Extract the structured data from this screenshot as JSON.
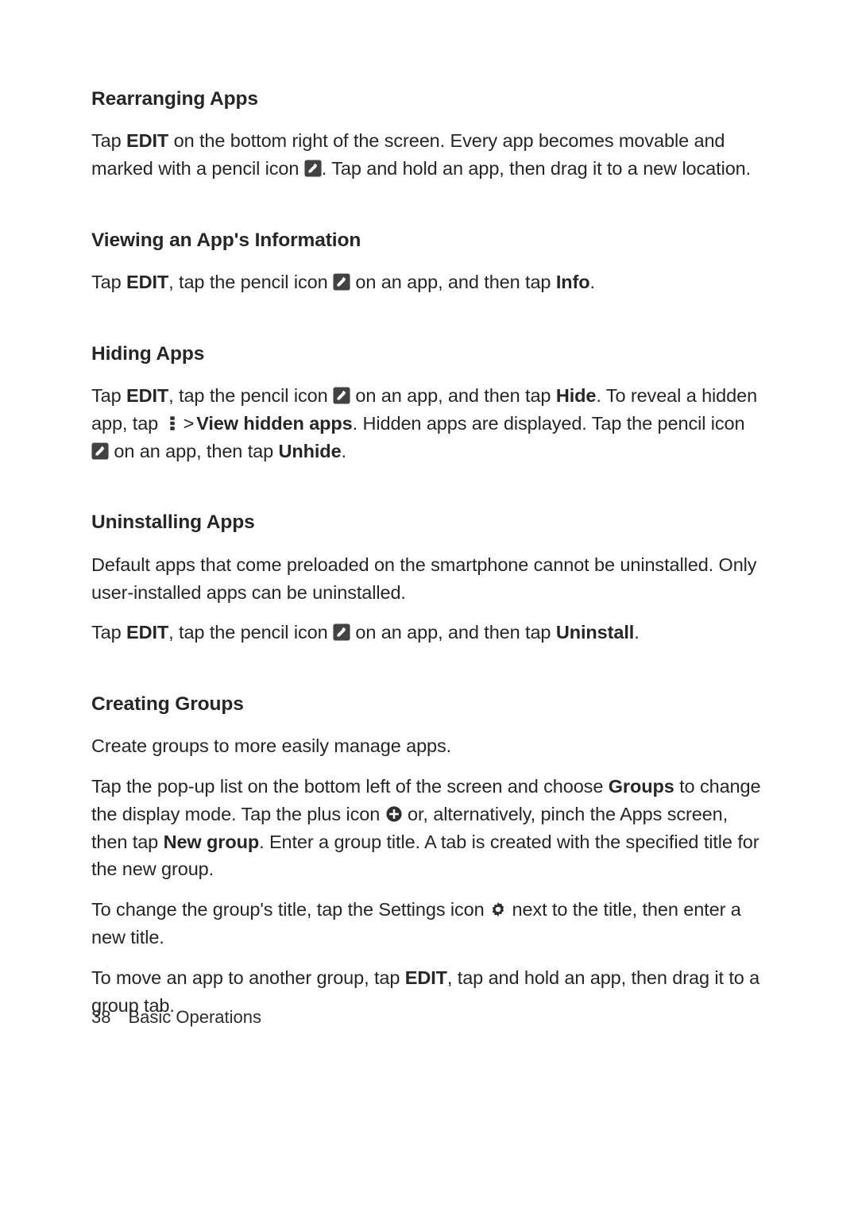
{
  "footer": {
    "page_number": "38",
    "chapter": "Basic Operations"
  },
  "gt": ">",
  "rearranging": {
    "heading": "Rearranging Apps",
    "p1a": "Tap ",
    "p1b": "EDIT",
    "p1c": " on the bottom right of the screen. Every app becomes movable and marked with a pencil icon ",
    "p1d": ". Tap and hold an app, then drag it to a new location."
  },
  "viewing": {
    "heading": "Viewing an App's Information",
    "p1a": "Tap ",
    "p1b": "EDIT",
    "p1c": ", tap the pencil icon ",
    "p1d": " on an app, and then tap ",
    "p1e": "Info",
    "p1f": "."
  },
  "hiding": {
    "heading": "Hiding Apps",
    "p1a": "Tap ",
    "p1b": "EDIT",
    "p1c": ", tap the pencil icon ",
    "p1d": " on an app, and then tap ",
    "p1e": "Hide",
    "p1f": ". To reveal a hidden app, tap ",
    "p1g": "View hidden apps",
    "p1h": ". Hidden apps are displayed. Tap the pencil icon ",
    "p1i": " on an app, then tap ",
    "p1j": "Unhide",
    "p1k": "."
  },
  "uninstall": {
    "heading": "Uninstalling Apps",
    "p1": "Default apps that come preloaded on the smartphone cannot be uninstalled. Only user-installed apps can be uninstalled.",
    "p2a": "Tap ",
    "p2b": "EDIT",
    "p2c": ", tap the pencil icon ",
    "p2d": " on an app, and then tap ",
    "p2e": "Uninstall",
    "p2f": "."
  },
  "groups": {
    "heading": "Creating Groups",
    "p1": "Create groups to more easily manage apps.",
    "p2a": "Tap the pop-up list on the bottom left of the screen and choose ",
    "p2b": "Groups",
    "p2c": " to change the display mode. Tap the plus icon ",
    "p2d": " or, alternatively, pinch the Apps screen, then tap ",
    "p2e": "New group",
    "p2f": ". Enter a group title. A tab is created with the specified title for the new group.",
    "p3a": "To change the group's title, tap the Settings icon ",
    "p3b": " next to the title, then enter a new title.",
    "p4a": "To move an app to another group, tap ",
    "p4b": "EDIT",
    "p4c": ", tap and hold an app, then drag it to a group tab."
  }
}
